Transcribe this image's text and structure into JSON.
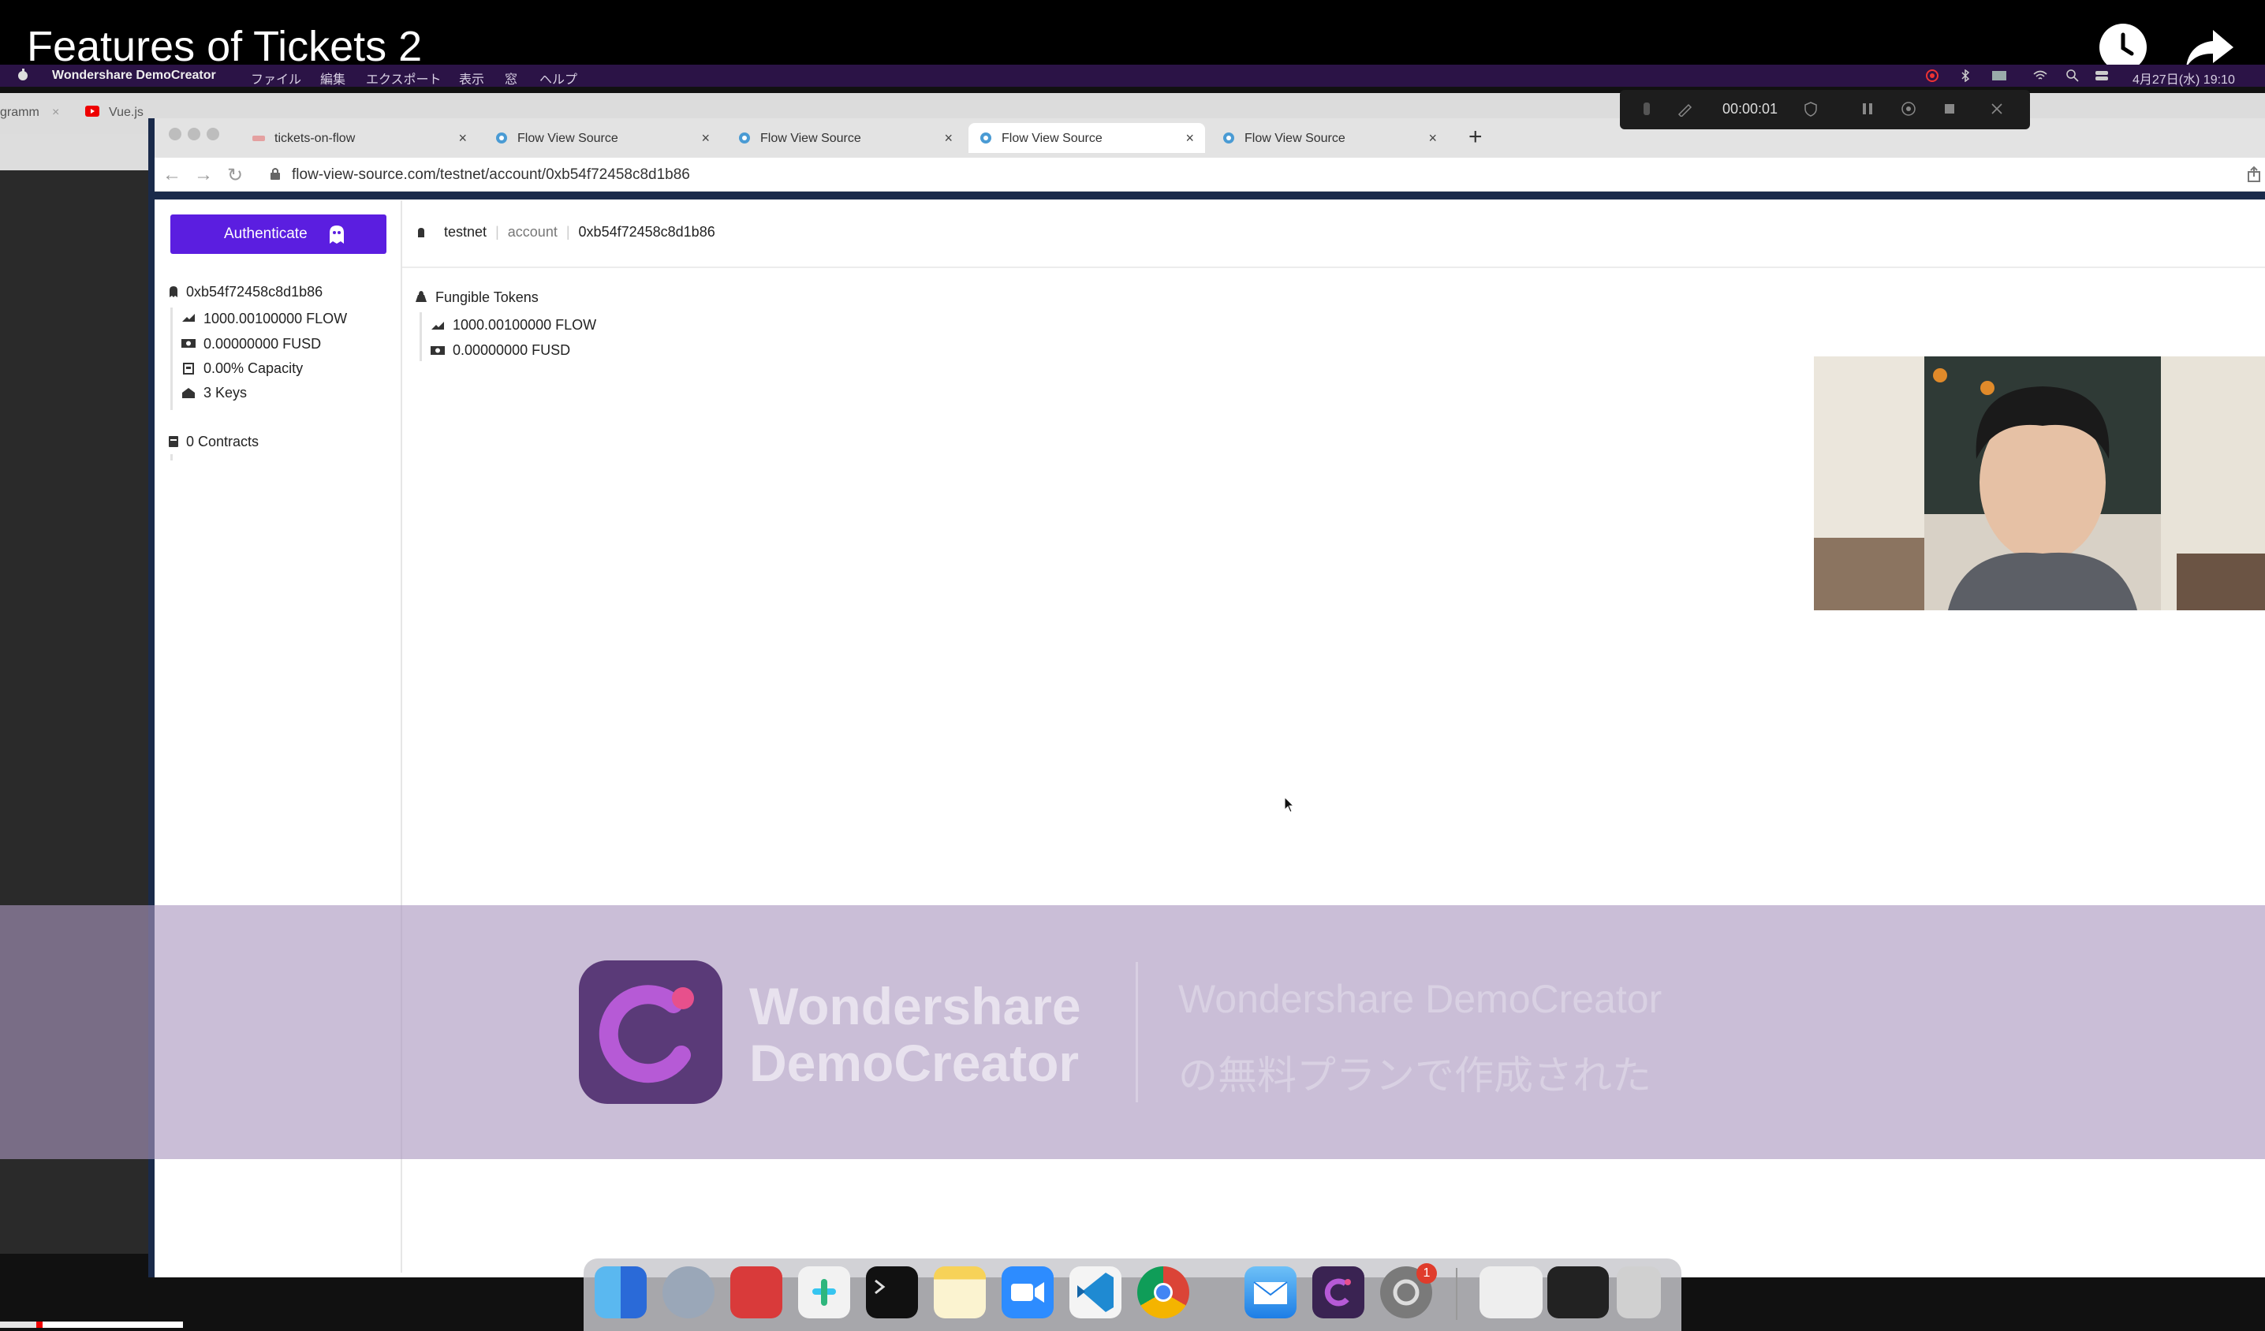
{
  "video": {
    "title": "Features of Tickets 2"
  },
  "menubar": {
    "app_name": "Wondershare DemoCreator",
    "items": [
      "ファイル",
      "編集",
      "エクスポート",
      "表示",
      "窓",
      "ヘルプ"
    ],
    "datetime": "4月27日(水) 19:10"
  },
  "background_tabs": [
    "gramm",
    "Vue.js"
  ],
  "recorder": {
    "elapsed": "00:00:01"
  },
  "browser": {
    "tabs": [
      {
        "label": "tickets-on-flow",
        "active": false
      },
      {
        "label": "Flow View Source",
        "active": false
      },
      {
        "label": "Flow View Source",
        "active": false
      },
      {
        "label": "Flow View Source",
        "active": true
      },
      {
        "label": "Flow View Source",
        "active": false
      }
    ],
    "new_tab": "+",
    "close_glyph": "×",
    "url": "flow-view-source.com/testnet/account/0xb54f72458c8d1b86"
  },
  "sidebar": {
    "auth_button": "Authenticate",
    "address": "0xb54f72458c8d1b86",
    "flow_balance": "1000.00100000 FLOW",
    "fusd_balance": "0.00000000 FUSD",
    "capacity": "0.00% Capacity",
    "keys": "3 Keys",
    "contracts": "0 Contracts"
  },
  "breadcrumb": {
    "network": "testnet",
    "section": "account",
    "address": "0xb54f72458c8d1b86"
  },
  "fungible_tokens": {
    "title": "Fungible Tokens",
    "flow": "1000.00100000 FLOW",
    "fusd": "0.00000000 FUSD"
  },
  "watermark": {
    "brand_line1": "Wondershare",
    "brand_line2": "DemoCreator",
    "sub_line1": "Wondershare DemoCreator",
    "sub_line2": "の無料プランで作成された"
  },
  "dock": {
    "apps": [
      "finder",
      "quicktime",
      "photo-booth",
      "slack",
      "terminal",
      "notes",
      "zoom",
      "vscode",
      "chrome",
      "mail",
      "democreator",
      "system-preferences"
    ],
    "badge": "1"
  },
  "colors": {
    "accent": "#5b1ee0",
    "menubar": "#2b1346",
    "watermark": "#5a3a78"
  }
}
